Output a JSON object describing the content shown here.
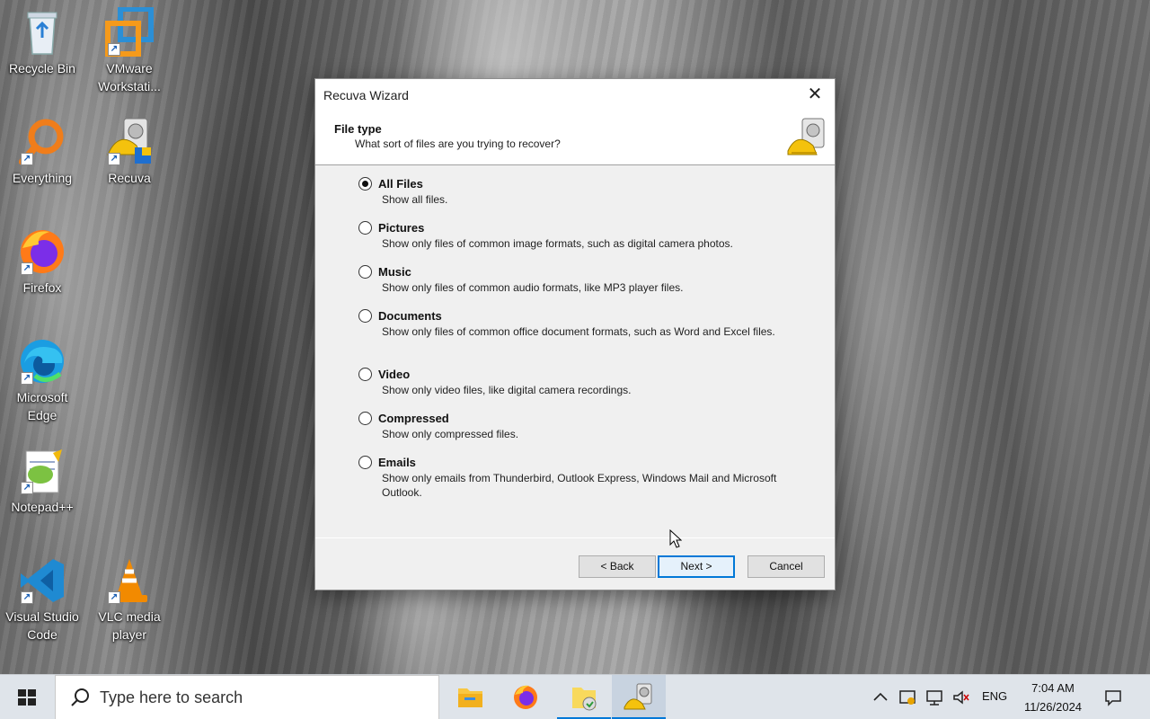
{
  "desktop": {
    "icons": [
      {
        "label": "Recycle Bin"
      },
      {
        "label": "VMware Workstati..."
      },
      {
        "label": "Everything"
      },
      {
        "label": "Recuva"
      },
      {
        "label": "Firefox"
      },
      {
        "label": "Microsoft Edge"
      },
      {
        "label": "Notepad++"
      },
      {
        "label": "Visual Studio Code"
      },
      {
        "label": "VLC media player"
      }
    ]
  },
  "dialog": {
    "title": "Recuva Wizard",
    "close_glyph": "✕",
    "header_title": "File type",
    "header_subtitle": "What sort of files are you trying to recover?",
    "selected": "All Files",
    "options": [
      {
        "label": "All Files",
        "desc": "Show all files.",
        "checked": true
      },
      {
        "label": "Pictures",
        "desc": "Show only files of common image formats, such as digital camera photos.",
        "checked": false
      },
      {
        "label": "Music",
        "desc": "Show only files of common audio formats, like MP3 player files.",
        "checked": false
      },
      {
        "label": "Documents",
        "desc": "Show only files of common office document formats, such as Word and Excel files.",
        "checked": false
      },
      {
        "label": "Video",
        "desc": "Show only video files, like digital camera recordings.",
        "checked": false
      },
      {
        "label": "Compressed",
        "desc": "Show only compressed files.",
        "checked": false
      },
      {
        "label": "Emails",
        "desc": "Show only emails from Thunderbird, Outlook Express, Windows Mail and Microsoft Outlook.",
        "checked": false
      }
    ],
    "buttons": {
      "back": "< Back",
      "next": "Next >",
      "cancel": "Cancel"
    }
  },
  "taskbar": {
    "search_placeholder": "Type here to search",
    "apps": [
      "file-explorer",
      "firefox",
      "file-manager",
      "recuva"
    ],
    "active_app": "recuva",
    "language": "ENG",
    "time": "7:04 AM",
    "date": "11/26/2024",
    "accent": "#0078d7"
  }
}
